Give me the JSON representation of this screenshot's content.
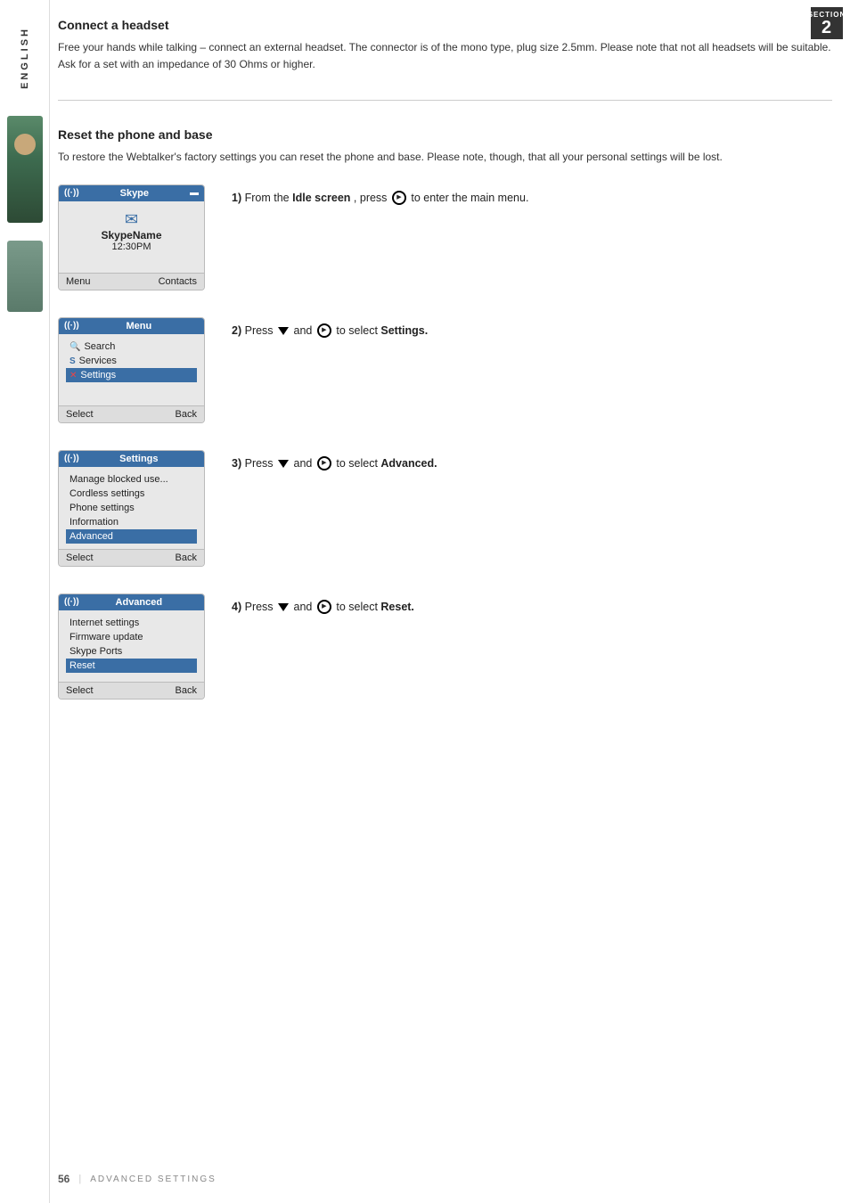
{
  "page": {
    "number": "56",
    "footer_label": "ADVANCED SETTINGS"
  },
  "section_badge": {
    "label": "SECTION",
    "number": "2"
  },
  "sidebar": {
    "language_label": "ENGLISH"
  },
  "connect_headset": {
    "title": "Connect a headset",
    "text": "Free your hands while talking – connect an external headset. The connector is of the mono type, plug size 2.5mm. Please note that not all headsets will be suitable. Ask for a set with an impedance of 30 Ohms or higher."
  },
  "reset_phone": {
    "title": "Reset the phone and base",
    "text": "To restore the Webtalker's factory settings you can reset the phone and base. Please note, though, that all your personal settings will be lost."
  },
  "steps": [
    {
      "num": "1)",
      "description_prefix": "From the ",
      "description_bold": "Idle screen",
      "description_suffix": ", press",
      "description_end": " to enter the main menu.",
      "phone": {
        "header_signal": "((·))",
        "header_title": "Skype",
        "header_battery": "▬",
        "body_type": "idle",
        "idle_icon": "✉",
        "idle_name": "SkypeName",
        "idle_time": "12:30PM",
        "footer_left": "Menu",
        "footer_right": "Contacts"
      }
    },
    {
      "num": "2)",
      "description_prefix": "Press",
      "description_suffix": " and",
      "description_end": " to select ",
      "description_bold_end": "Settings.",
      "phone": {
        "header_signal": "((·))",
        "header_title": "Menu",
        "header_battery": "",
        "body_type": "menu",
        "items": [
          {
            "label": "Search",
            "icon": "search",
            "selected": false
          },
          {
            "label": "Services",
            "icon": "services",
            "selected": false
          },
          {
            "label": "Settings",
            "icon": "settings",
            "selected": true
          }
        ],
        "footer_left": "Select",
        "footer_right": "Back"
      }
    },
    {
      "num": "3)",
      "description_prefix": "Press",
      "description_suffix": " and",
      "description_end": " to select ",
      "description_bold_end": "Advanced.",
      "phone": {
        "header_signal": "((·))",
        "header_title": "Settings",
        "header_battery": "",
        "body_type": "settings",
        "items": [
          {
            "label": "Manage blocked use...",
            "selected": false
          },
          {
            "label": "Cordless settings",
            "selected": false
          },
          {
            "label": "Phone settings",
            "selected": false
          },
          {
            "label": "Information",
            "selected": false
          },
          {
            "label": "Advanced",
            "selected": true
          }
        ],
        "footer_left": "Select",
        "footer_right": "Back"
      }
    },
    {
      "num": "4)",
      "description_prefix": "Press",
      "description_suffix": " and",
      "description_end": " to select ",
      "description_bold_end": "Reset.",
      "phone": {
        "header_signal": "((·))",
        "header_title": "Advanced",
        "header_battery": "",
        "body_type": "advanced",
        "items": [
          {
            "label": "Internet settings",
            "selected": false
          },
          {
            "label": "Firmware update",
            "selected": false
          },
          {
            "label": "Skype Ports",
            "selected": false
          },
          {
            "label": "Reset",
            "selected": true
          }
        ],
        "footer_left": "Select",
        "footer_right": "Back"
      }
    }
  ]
}
